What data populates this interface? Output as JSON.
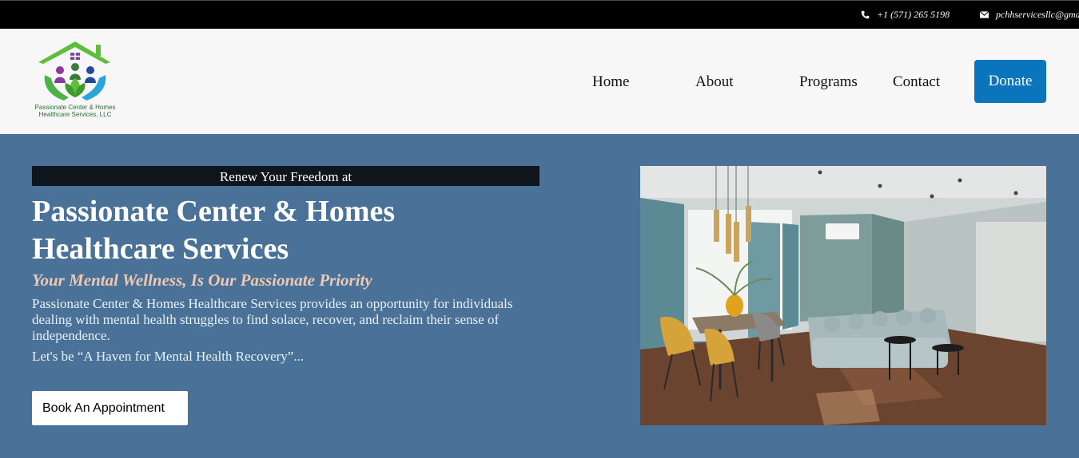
{
  "topbar": {
    "phone": "+1 (571) 265 5198",
    "email": "pchhservicesllc@gmail.com",
    "phone_icon": "phone-icon",
    "email_icon": "envelope-icon"
  },
  "header": {
    "logo_line1": "Passionate Center & Homes",
    "logo_line2": "Healthcare Services, LLC",
    "nav": {
      "home": "Home",
      "about": "About",
      "programs": "Programs",
      "contact": "Contact"
    },
    "donate": "Donate"
  },
  "hero": {
    "tagline": "Renew Your Freedom at",
    "title": "Passionate Center & Homes Healthcare Services",
    "subtitle": "Your Mental Wellness, Is Our Passionate Priority",
    "description": "Passionate Center & Homes Healthcare Services provides an opportunity for individuals dealing with mental health struggles to find solace, recover, and reclaim their sense of independence.",
    "haven": "Let's be “A Haven for Mental Health Recovery”...",
    "button": "Book An Appointment"
  },
  "colors": {
    "topbar_bg": "#000000",
    "header_bg": "#f7f7f7",
    "hero_bg": "#4a7298",
    "donate_bg": "#0a74bd",
    "subtitle": "#f0c9b2",
    "tagline_bg": "#0f151c"
  }
}
